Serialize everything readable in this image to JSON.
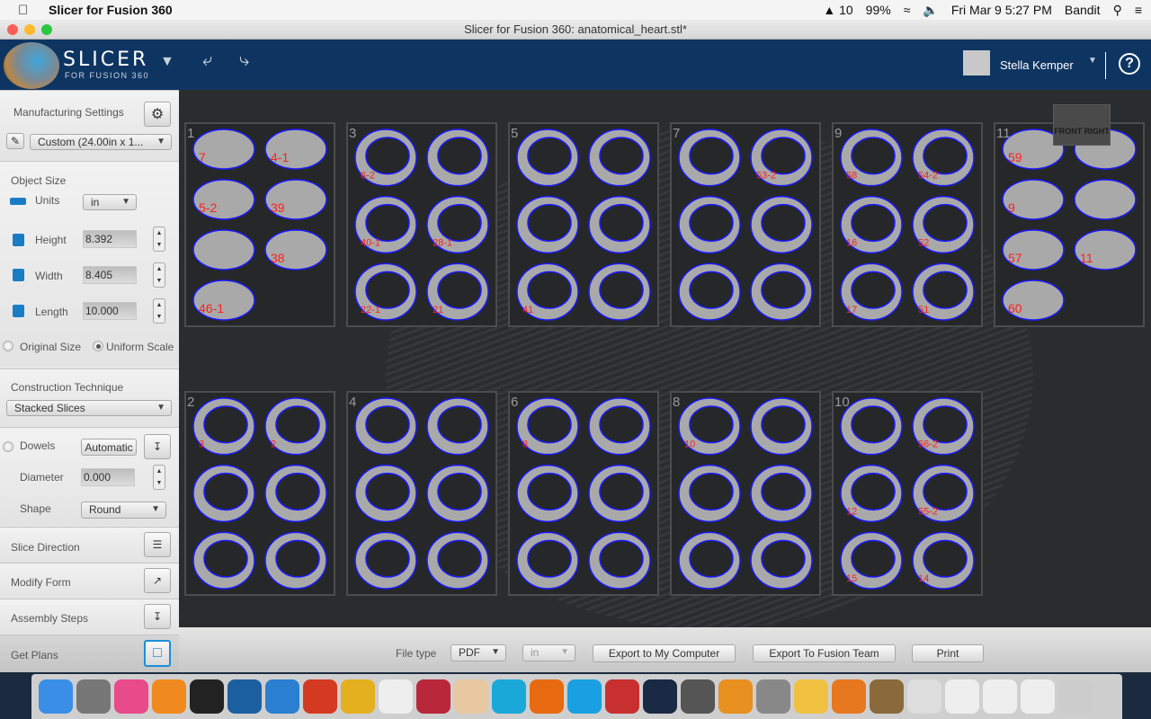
{
  "menubar": {
    "app_name": "Slicer for Fusion 360",
    "status": {
      "adobe": "10",
      "battery": "99%",
      "datetime": "Fri Mar 9  5:27 PM",
      "user": "Bandit"
    }
  },
  "window": {
    "title": "Slicer for Fusion 360: anatomical_heart.stl*"
  },
  "header": {
    "logo_title": "SLICER",
    "logo_subtitle": "FOR FUSION 360",
    "user_name": "Stella Kemper",
    "help": "?"
  },
  "sidebar": {
    "manufacturing": {
      "label": "Manufacturing Settings",
      "preset": "Custom (24.00in x 1..."
    },
    "object_size": {
      "label": "Object Size",
      "units_label": "Units",
      "units": "in",
      "height_label": "Height",
      "height": "8.392",
      "width_label": "Width",
      "width": "8.405",
      "length_label": "Length",
      "length": "10.000",
      "original_size": "Original Size",
      "uniform_scale": "Uniform Scale",
      "uniform_scale_selected": true
    },
    "construction": {
      "label": "Construction Technique",
      "technique": "Stacked Slices"
    },
    "dowels": {
      "label": "Dowels",
      "mode": "Automatic",
      "diameter_label": "Diameter",
      "diameter": "0.000",
      "shape_label": "Shape",
      "shape": "Round"
    },
    "steps": [
      {
        "label": "Slice Direction"
      },
      {
        "label": "Modify Form"
      },
      {
        "label": "Assembly Steps"
      },
      {
        "label": "Get Plans"
      }
    ]
  },
  "navcube": {
    "front": "FRONT",
    "right": "RIGHT"
  },
  "sheets": [
    {
      "num": "1",
      "pieces": [
        "7",
        "4-1",
        "5-2",
        "39",
        "",
        "38",
        "46-1"
      ]
    },
    {
      "num": "3",
      "pieces": [
        "6-2",
        "",
        "40-1",
        "28-1",
        "22-1",
        "21"
      ]
    },
    {
      "num": "5",
      "pieces": [
        "",
        "",
        "",
        "",
        "41",
        ""
      ]
    },
    {
      "num": "7",
      "pieces": [
        "",
        "53-2",
        "",
        "",
        "",
        ""
      ]
    },
    {
      "num": "9",
      "pieces": [
        "58",
        "54-2",
        "16",
        "52",
        "17",
        "51"
      ]
    },
    {
      "num": "11",
      "pieces": [
        "59",
        "",
        "9",
        "",
        "57",
        "11",
        "60"
      ]
    },
    {
      "num": "2",
      "pieces": [
        "3",
        "2",
        "",
        "",
        "",
        ""
      ]
    },
    {
      "num": "4",
      "pieces": [
        "",
        "",
        "",
        "",
        "",
        ""
      ]
    },
    {
      "num": "6",
      "pieces": [
        "8",
        "",
        "",
        "",
        "",
        ""
      ]
    },
    {
      "num": "8",
      "pieces": [
        "10",
        "",
        "",
        "",
        "",
        ""
      ]
    },
    {
      "num": "10",
      "pieces": [
        "",
        "56-2",
        "12",
        "55-2",
        "15",
        "14"
      ]
    }
  ],
  "bottombar": {
    "file_type_label": "File type",
    "file_type": "PDF",
    "units": "in",
    "export_computer": "Export to My Computer",
    "export_team": "Export To Fusion Team",
    "print": "Print"
  },
  "dock": [
    "Finder",
    "Launchpad",
    "iTunes",
    "iBooks",
    "Inkscape",
    "Photoshop",
    "Word",
    "WPS",
    "Chrome",
    "TextEdit",
    "App",
    "App",
    "Vectorize",
    "Firefox",
    "Skype",
    "Vivaldi",
    "Steam",
    "Calculator",
    "Scratch",
    "Disk Utility",
    "Photos",
    "Fusion 360",
    "Slicer",
    "Document",
    "Document",
    "Document",
    "Document",
    "Trash"
  ],
  "colors": {
    "header": "#0e3562",
    "cut_line": "#1a1aff",
    "etch": "#ff2020",
    "piece": "#a9a9a9",
    "accent": "#1a7dc4"
  }
}
